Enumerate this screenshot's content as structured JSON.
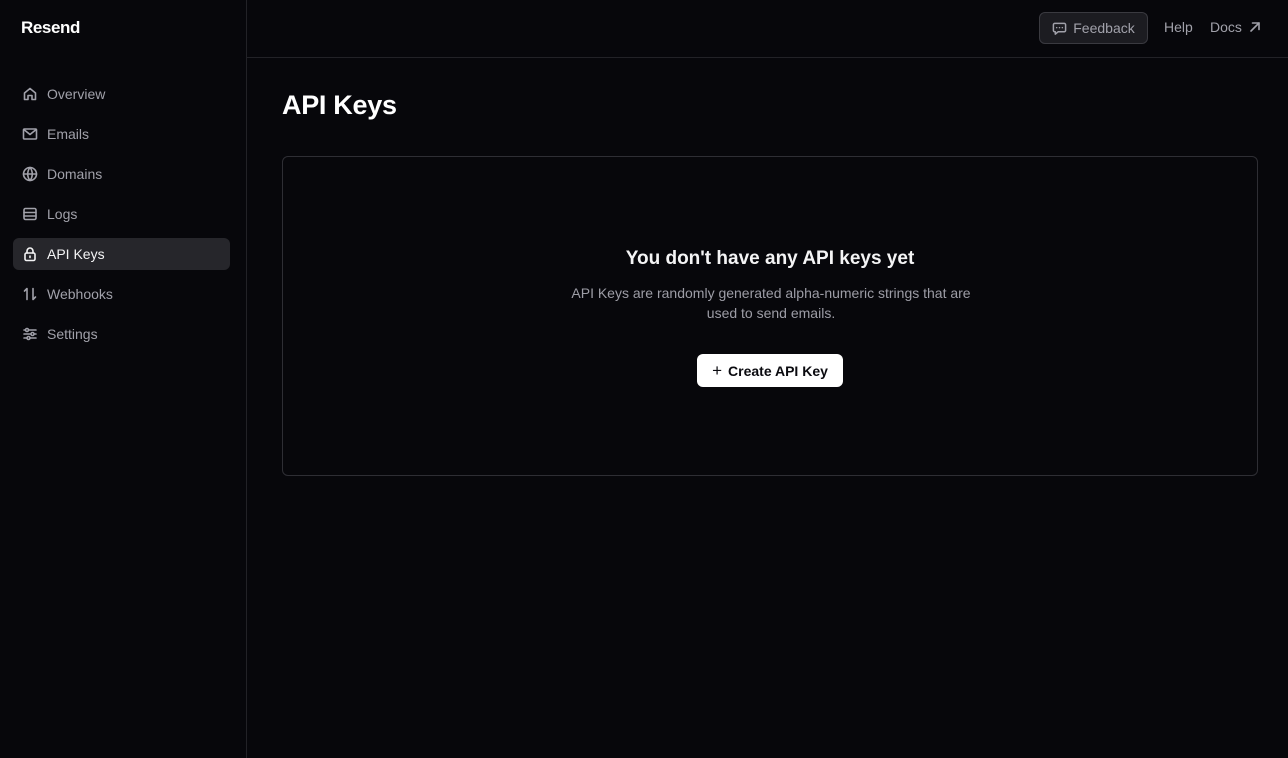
{
  "brand": {
    "name": "Resend"
  },
  "sidebar": {
    "items": [
      {
        "label": "Overview",
        "icon": "home-icon"
      },
      {
        "label": "Emails",
        "icon": "mail-icon"
      },
      {
        "label": "Domains",
        "icon": "globe-icon"
      },
      {
        "label": "Logs",
        "icon": "logs-icon"
      },
      {
        "label": "API Keys",
        "icon": "lock-icon",
        "active": true
      },
      {
        "label": "Webhooks",
        "icon": "arrows-updown-icon"
      },
      {
        "label": "Settings",
        "icon": "sliders-icon"
      }
    ]
  },
  "topbar": {
    "feedback_label": "Feedback",
    "help_label": "Help",
    "docs_label": "Docs"
  },
  "main": {
    "title": "API Keys",
    "empty": {
      "title": "You don't have any API keys yet",
      "description": "API Keys are randomly generated alpha-numeric strings that are used to send emails.",
      "button_label": "Create API Key"
    }
  },
  "colors": {
    "background": "#07070b",
    "active_item": "#26262b",
    "border": "#222227",
    "button_bg": "#ffffff"
  }
}
